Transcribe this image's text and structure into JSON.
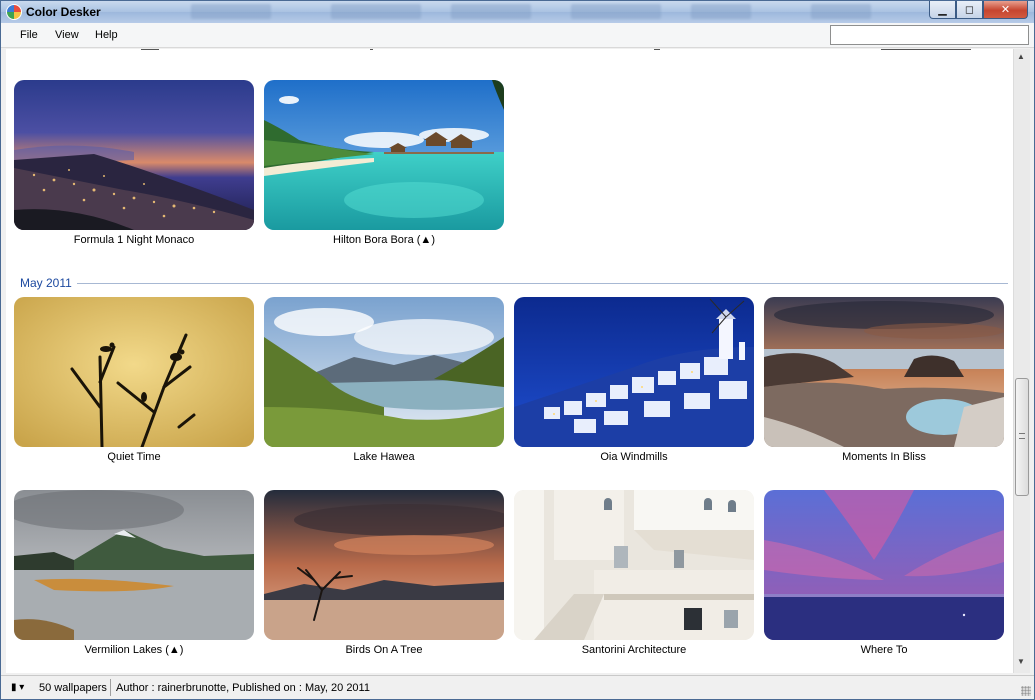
{
  "window": {
    "title": "Color Desker",
    "caption_buttons": {
      "minimize": "▁",
      "maximize": "◻",
      "close": "✕"
    }
  },
  "menu": {
    "items": [
      "File",
      "View",
      "Help"
    ]
  },
  "search": {
    "placeholder": "",
    "value": ""
  },
  "sections": [
    {
      "label": "",
      "tiles": [
        {
          "caption": "Formula 1 Night Monaco",
          "scene": "monaco"
        },
        {
          "caption": "Hilton Bora Bora (▲)",
          "scene": "borabora"
        }
      ]
    },
    {
      "label": "May 2011",
      "tiles": [
        {
          "caption": "Quiet Time",
          "scene": "quiet"
        },
        {
          "caption": "Lake Hawea",
          "scene": "hawea"
        },
        {
          "caption": "Oia Windmills",
          "scene": "oia"
        },
        {
          "caption": "Moments In Bliss",
          "scene": "bliss"
        },
        {
          "caption": "Vermilion Lakes (▲)",
          "scene": "vermilion"
        },
        {
          "caption": "Birds On A Tree",
          "scene": "birds"
        },
        {
          "caption": "Santorini Architecture",
          "scene": "santorini"
        },
        {
          "caption": "Where To",
          "scene": "whereto"
        }
      ]
    }
  ],
  "status": {
    "view_icon": "▮ ▾",
    "count": "50 wallpapers",
    "author": "Author : rainerbrunotte, Published on : May, 20 2011"
  },
  "scrollbar": {
    "up_arrow": "▲",
    "down_arrow": "▼"
  }
}
